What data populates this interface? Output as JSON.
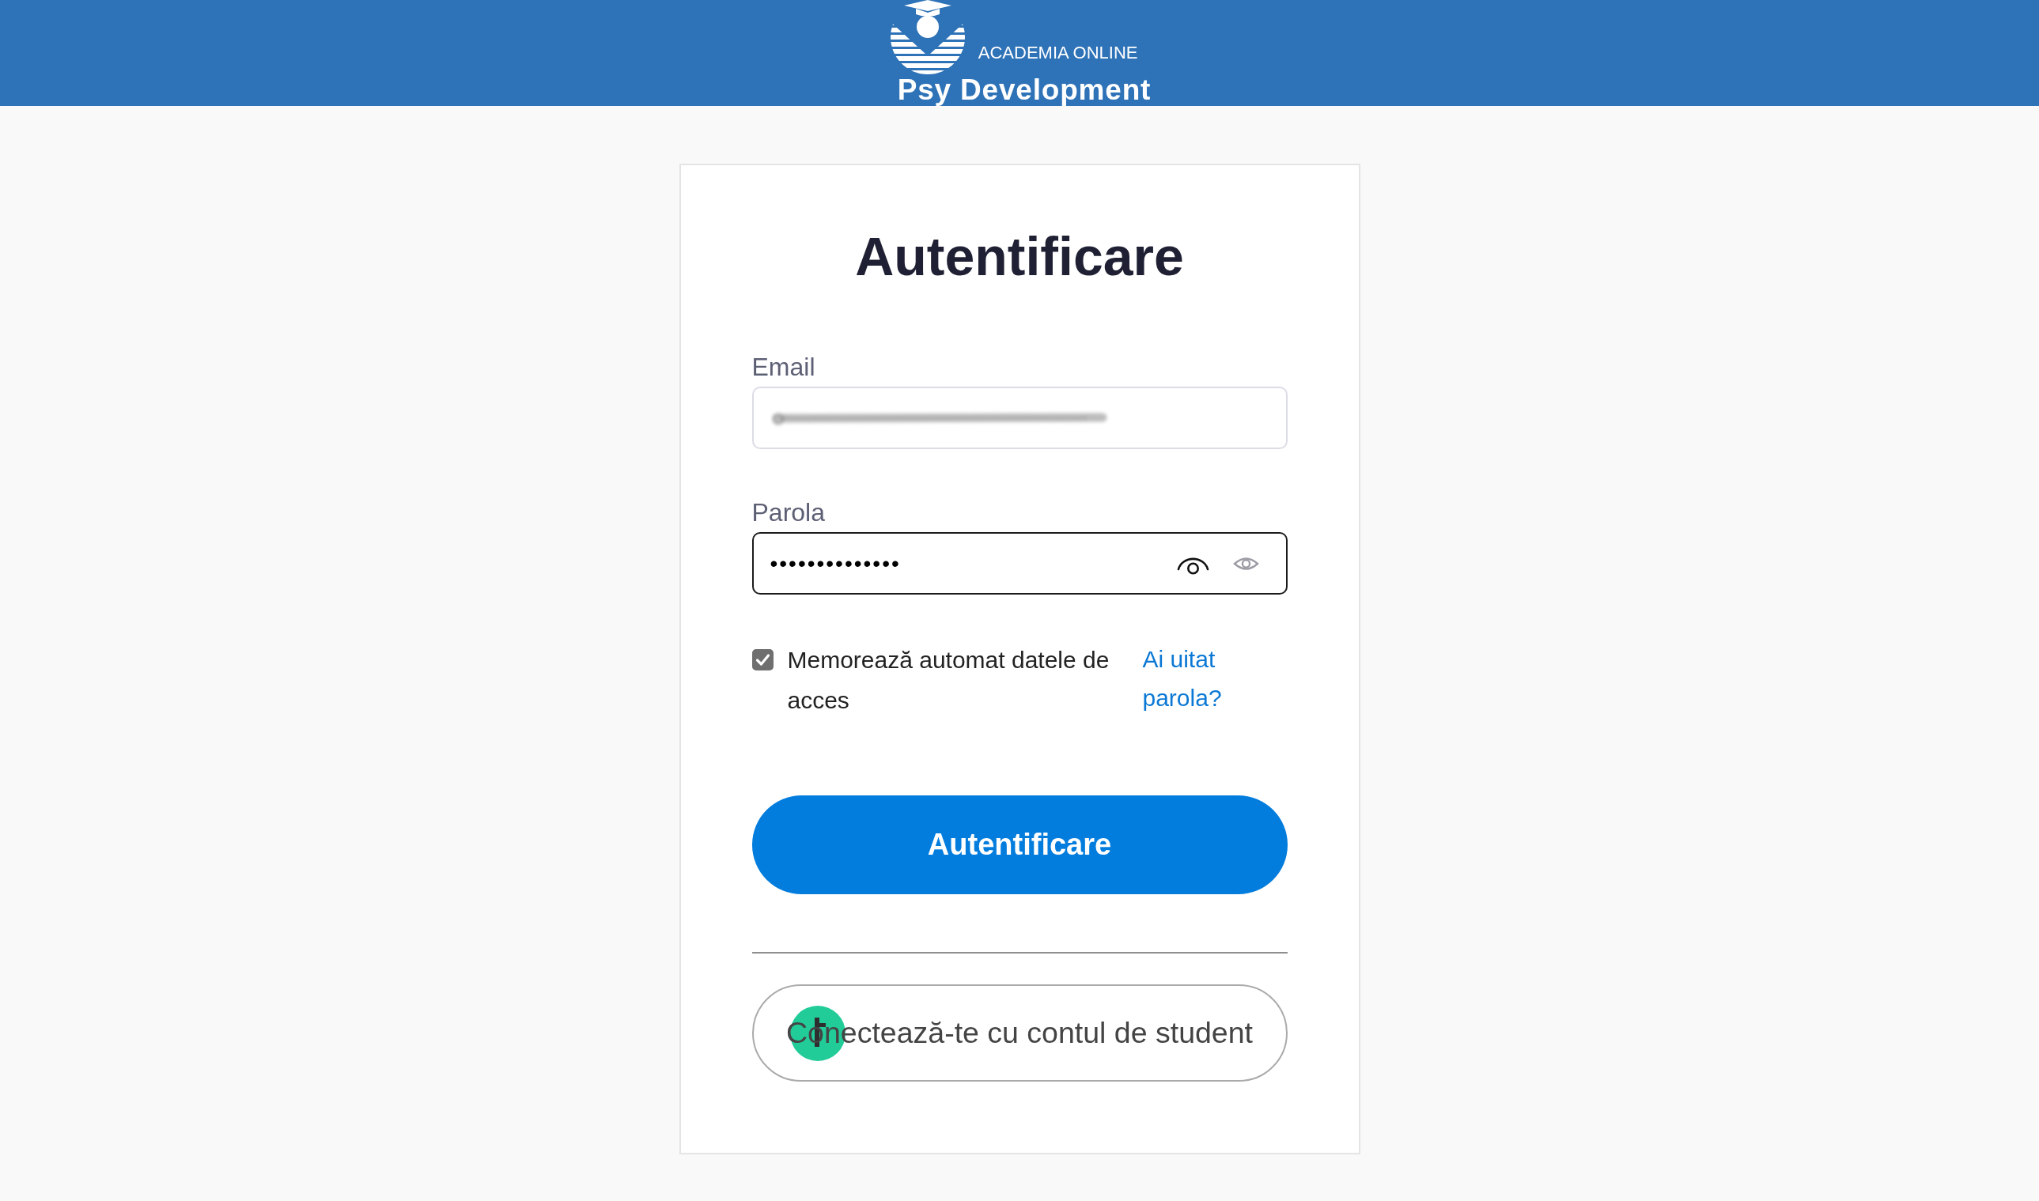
{
  "header": {
    "logo": {
      "tagline": "ACADEMIA ONLINE",
      "name": "Psy Development"
    }
  },
  "login_card": {
    "title": "Autentificare",
    "fields": [
      {
        "kind": "email",
        "label": "Email",
        "redacted": true,
        "focused": false
      },
      {
        "kind": "password",
        "label": "Parola",
        "value": "••••••••••••••",
        "focused": true
      }
    ],
    "remember": {
      "label": "Memorează automat datele de acces",
      "checked": true
    },
    "forgot_link": "Ai uitat parola?",
    "submit_button": "Autentificare",
    "student_button": {
      "label": "Conectează-te cu contul de student",
      "click_marker": true
    }
  }
}
